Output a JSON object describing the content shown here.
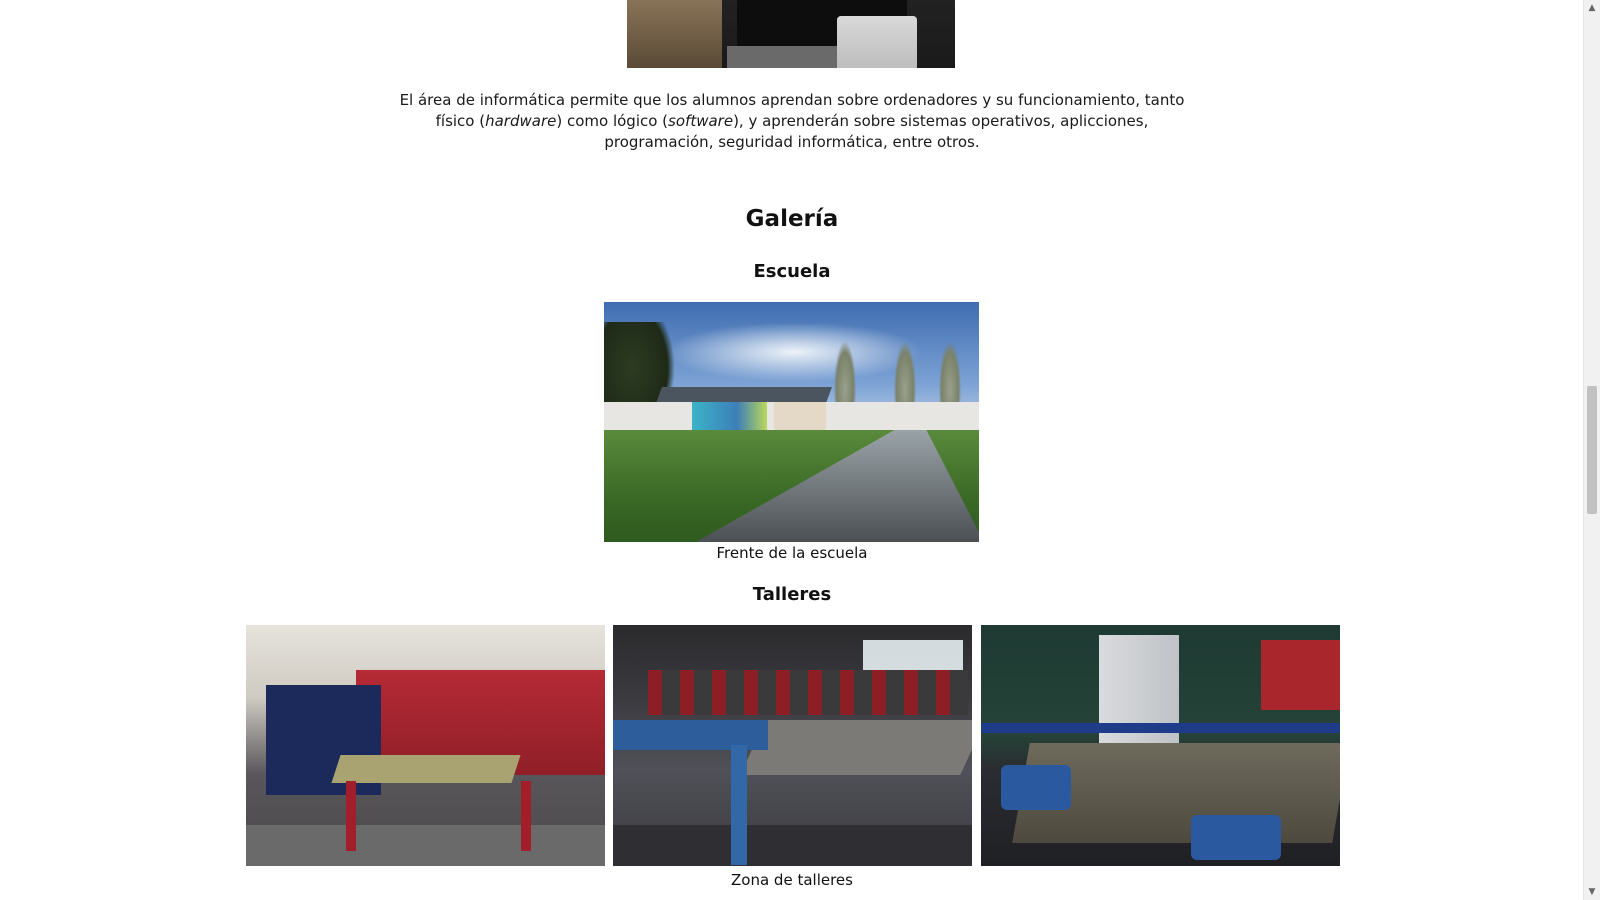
{
  "intro": {
    "part1": "El área de informática permite que los alumnos aprendan sobre ordenadores y su funcionamiento, tanto físico (",
    "hardware": "hardware",
    "part2": ") como lógico (",
    "software": "software",
    "part3": "), y aprenderán sobre sistemas operativos, aplicciones, programación, seguridad informática, entre otros."
  },
  "gallery": {
    "title": "Galería",
    "escuela": {
      "heading": "Escuela",
      "caption": "Frente de la escuela"
    },
    "talleres": {
      "heading": "Talleres",
      "caption": "Zona de talleres"
    }
  },
  "scrollbar": {
    "up_icon": "▲",
    "down_icon": "▼"
  }
}
